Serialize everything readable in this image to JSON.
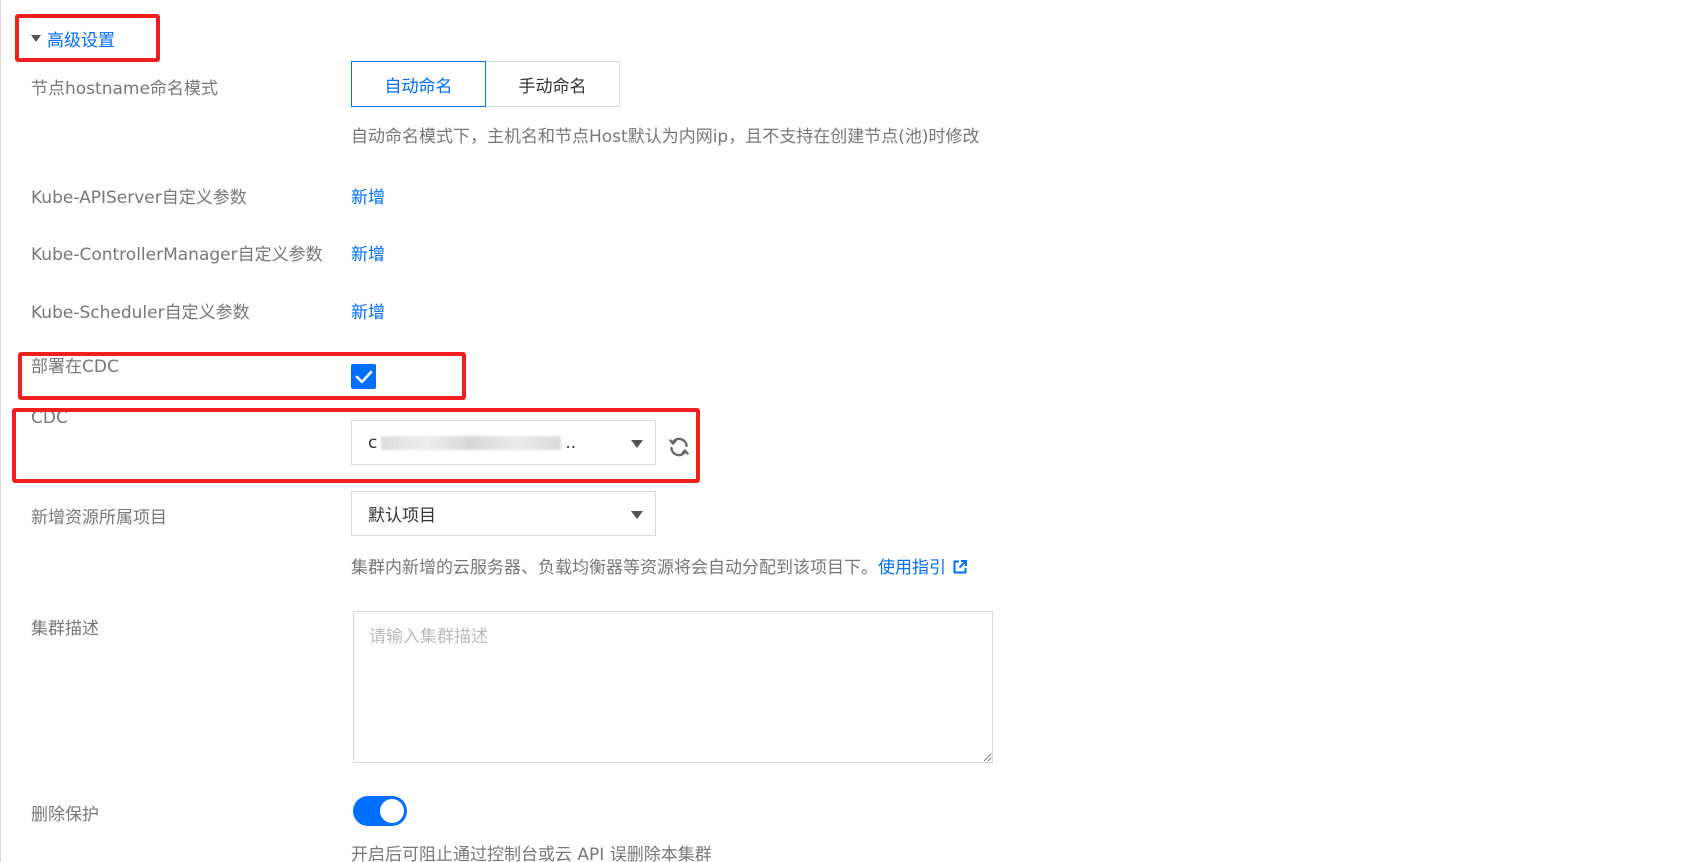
{
  "section": {
    "title": "高级设置"
  },
  "hostname": {
    "label": "节点hostname命名模式",
    "options": [
      "自动命名",
      "手动命名"
    ],
    "selected": "自动命名",
    "hint": "自动命名模式下，主机名和节点Host默认为内网ip，且不支持在创建节点(池)时修改"
  },
  "apiserver": {
    "label": "Kube-APIServer自定义参数",
    "action": "新增"
  },
  "controller": {
    "label": "Kube-ControllerManager自定义参数",
    "action": "新增"
  },
  "scheduler": {
    "label": "Kube-Scheduler自定义参数",
    "action": "新增"
  },
  "cdc_deploy": {
    "label": "部署在CDC",
    "checked": true
  },
  "cdc": {
    "label": "CDC",
    "value_prefix": "c",
    "value_suffix": ".."
  },
  "project": {
    "label": "新增资源所属项目",
    "value": "默认项目",
    "hint": "集群内新增的云服务器、负载均衡器等资源将会自动分配到该项目下。",
    "link": "使用指引"
  },
  "description": {
    "label": "集群描述",
    "placeholder": "请输入集群描述"
  },
  "protection": {
    "label": "删除保护",
    "enabled": true,
    "hint": "开启后可阻止通过控制台或云 API 误删除本集群"
  },
  "colors": {
    "accent": "#006eff",
    "highlight": "#f02020",
    "label": "#777777"
  }
}
